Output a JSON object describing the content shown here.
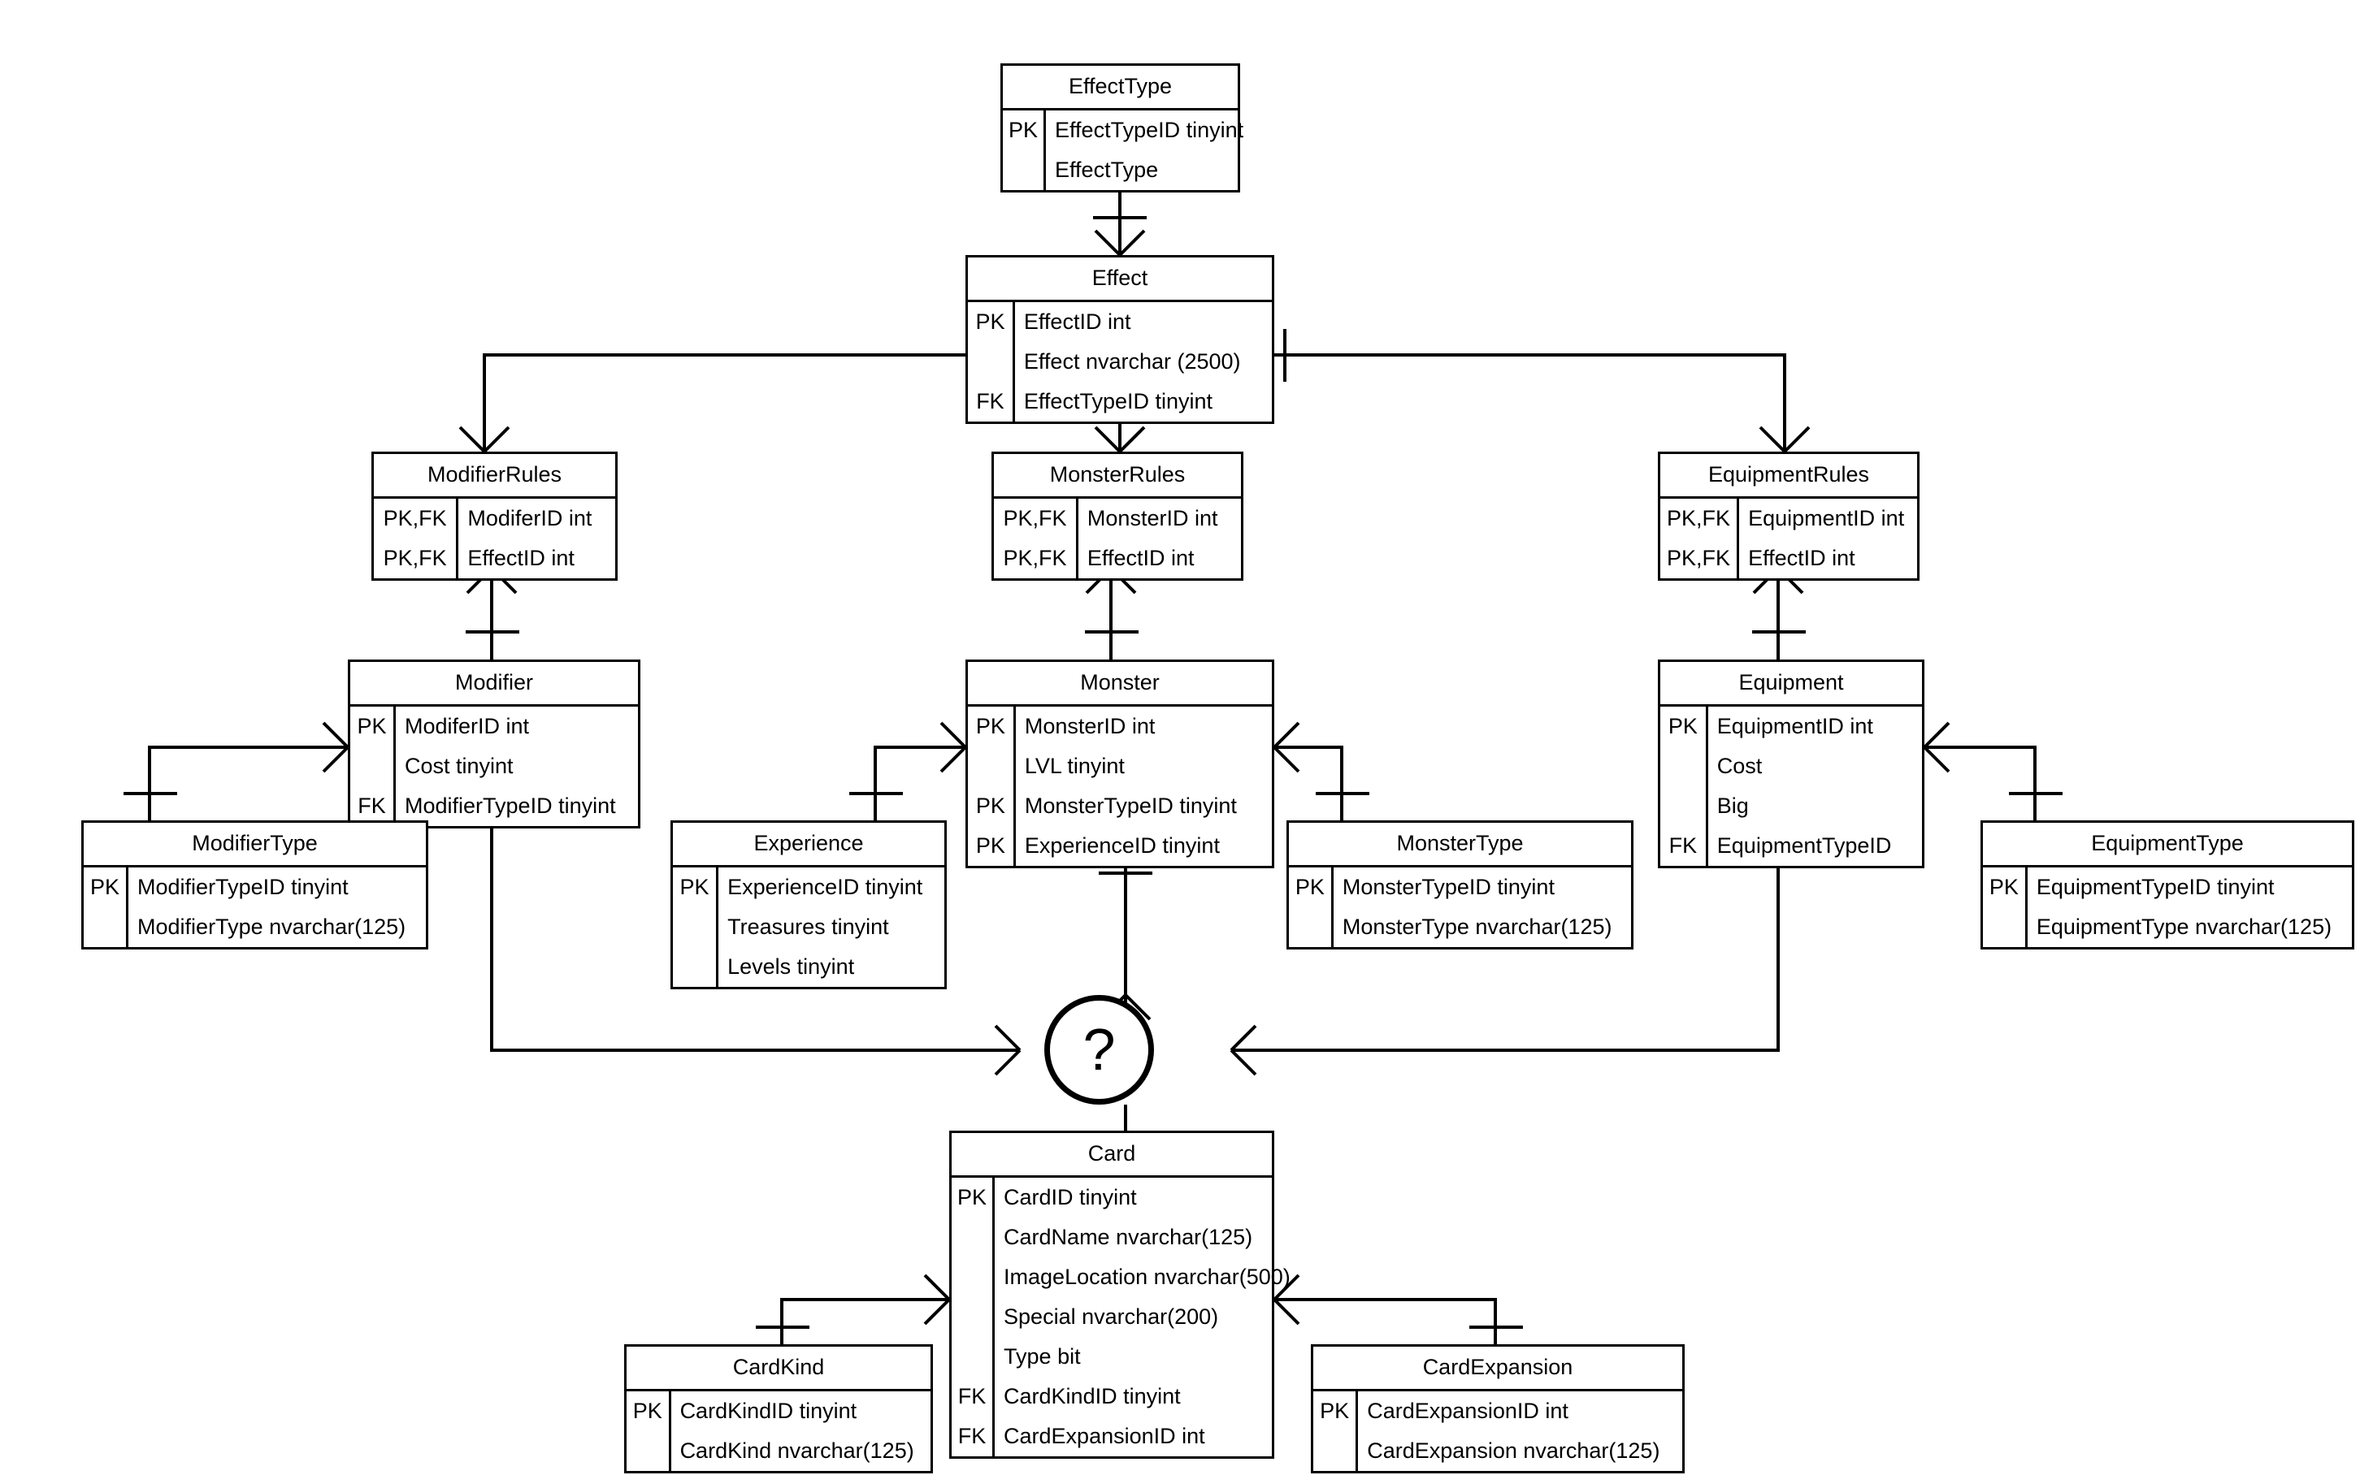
{
  "diagram": {
    "title": "Card Game Database ER Diagram",
    "notation": "crow's foot",
    "line_color": "#000000",
    "background_color": "#ffffff",
    "unknown_node_label": "?"
  },
  "entities": [
    {
      "id": "effecttype",
      "name": "EffectType",
      "attributes": [
        {
          "key": "PK",
          "name": "EffectTypeID tinyint"
        },
        {
          "key": "",
          "name": "EffectType"
        }
      ]
    },
    {
      "id": "effect",
      "name": "Effect",
      "attributes": [
        {
          "key": "PK",
          "name": "EffectID int"
        },
        {
          "key": "",
          "name": "Effect nvarchar (2500)"
        },
        {
          "key": "FK",
          "name": "EffectTypeID tinyint"
        }
      ]
    },
    {
      "id": "modifierrules",
      "name": "ModifierRules",
      "attributes": [
        {
          "key": "PK,FK",
          "name": "ModiferID int"
        },
        {
          "key": "PK,FK",
          "name": "EffectID int"
        }
      ]
    },
    {
      "id": "monsterrules",
      "name": "MonsterRules",
      "attributes": [
        {
          "key": "PK,FK",
          "name": "MonsterID int"
        },
        {
          "key": "PK,FK",
          "name": "EffectID int"
        }
      ]
    },
    {
      "id": "equipmentrules",
      "name": "EquipmentRules",
      "attributes": [
        {
          "key": "PK,FK",
          "name": "EquipmentID int"
        },
        {
          "key": "PK,FK",
          "name": "EffectID int"
        }
      ]
    },
    {
      "id": "modifier",
      "name": "Modifier",
      "attributes": [
        {
          "key": "PK",
          "name": "ModiferID int"
        },
        {
          "key": "",
          "name": "Cost tinyint"
        },
        {
          "key": "FK",
          "name": "ModifierTypeID tinyint"
        }
      ]
    },
    {
      "id": "monster",
      "name": "Monster",
      "attributes": [
        {
          "key": "PK",
          "name": "MonsterID int"
        },
        {
          "key": "",
          "name": "LVL tinyint"
        },
        {
          "key": "PK",
          "name": "MonsterTypeID tinyint"
        },
        {
          "key": "PK",
          "name": "ExperienceID tinyint"
        }
      ]
    },
    {
      "id": "equipment",
      "name": "Equipment",
      "attributes": [
        {
          "key": "PK",
          "name": "EquipmentID int"
        },
        {
          "key": "",
          "name": "Cost"
        },
        {
          "key": "",
          "name": "Big"
        },
        {
          "key": "FK",
          "name": "EquipmentTypeID"
        }
      ]
    },
    {
      "id": "modifiertype",
      "name": "ModifierType",
      "attributes": [
        {
          "key": "PK",
          "name": "ModifierTypeID tinyint"
        },
        {
          "key": "",
          "name": "ModifierType nvarchar(125)"
        }
      ]
    },
    {
      "id": "experience",
      "name": "Experience",
      "attributes": [
        {
          "key": "PK",
          "name": "ExperienceID tinyint"
        },
        {
          "key": "",
          "name": "Treasures tinyint"
        },
        {
          "key": "",
          "name": "Levels tinyint"
        }
      ]
    },
    {
      "id": "monstertype",
      "name": "MonsterType",
      "attributes": [
        {
          "key": "PK",
          "name": "MonsterTypeID tinyint"
        },
        {
          "key": "",
          "name": "MonsterType nvarchar(125)"
        }
      ]
    },
    {
      "id": "equipmenttype",
      "name": "EquipmentType",
      "attributes": [
        {
          "key": "PK",
          "name": "EquipmentTypeID tinyint"
        },
        {
          "key": "",
          "name": "EquipmentType nvarchar(125)"
        }
      ]
    },
    {
      "id": "card",
      "name": "Card",
      "attributes": [
        {
          "key": "PK",
          "name": "CardID tinyint"
        },
        {
          "key": "",
          "name": "CardName nvarchar(125)"
        },
        {
          "key": "",
          "name": "ImageLocation nvarchar(500)"
        },
        {
          "key": "",
          "name": "Special nvarchar(200)"
        },
        {
          "key": "",
          "name": "Type bit"
        },
        {
          "key": "FK",
          "name": "CardKindID tinyint"
        },
        {
          "key": "FK",
          "name": "CardExpansionID int"
        }
      ]
    },
    {
      "id": "cardkind",
      "name": "CardKind",
      "attributes": [
        {
          "key": "PK",
          "name": "CardKindID tinyint"
        },
        {
          "key": "",
          "name": "CardKind nvarchar(125)"
        }
      ]
    },
    {
      "id": "cardexpansion",
      "name": "CardExpansion",
      "attributes": [
        {
          "key": "PK",
          "name": "CardExpansionID int"
        },
        {
          "key": "",
          "name": "CardExpansion nvarchar(125)"
        }
      ]
    }
  ],
  "relationships": [
    {
      "from": "EffectType",
      "to": "Effect",
      "from_card": "one",
      "to_card": "many"
    },
    {
      "from": "Effect",
      "to": "ModifierRules",
      "from_card": "one",
      "to_card": "many"
    },
    {
      "from": "Effect",
      "to": "MonsterRules",
      "from_card": "one",
      "to_card": "many"
    },
    {
      "from": "Effect",
      "to": "EquipmentRules",
      "from_card": "one",
      "to_card": "many"
    },
    {
      "from": "Modifier",
      "to": "ModifierRules",
      "from_card": "one",
      "to_card": "many"
    },
    {
      "from": "Monster",
      "to": "MonsterRules",
      "from_card": "one",
      "to_card": "many"
    },
    {
      "from": "Equipment",
      "to": "EquipmentRules",
      "from_card": "one",
      "to_card": "many"
    },
    {
      "from": "ModifierType",
      "to": "Modifier",
      "from_card": "one",
      "to_card": "many"
    },
    {
      "from": "Experience",
      "to": "Monster",
      "from_card": "one",
      "to_card": "many"
    },
    {
      "from": "MonsterType",
      "to": "Monster",
      "from_card": "one",
      "to_card": "many"
    },
    {
      "from": "EquipmentType",
      "to": "Equipment",
      "from_card": "one",
      "to_card": "many"
    },
    {
      "from": "Monster",
      "to": "?",
      "from_card": "one",
      "to_card": "many"
    },
    {
      "from": "Modifier",
      "to": "?",
      "from_card": "one",
      "to_card": "many"
    },
    {
      "from": "Equipment",
      "to": "?",
      "from_card": "one",
      "to_card": "many"
    },
    {
      "from": "CardKind",
      "to": "Card",
      "from_card": "one",
      "to_card": "many"
    },
    {
      "from": "CardExpansion",
      "to": "Card",
      "from_card": "one",
      "to_card": "many"
    }
  ]
}
